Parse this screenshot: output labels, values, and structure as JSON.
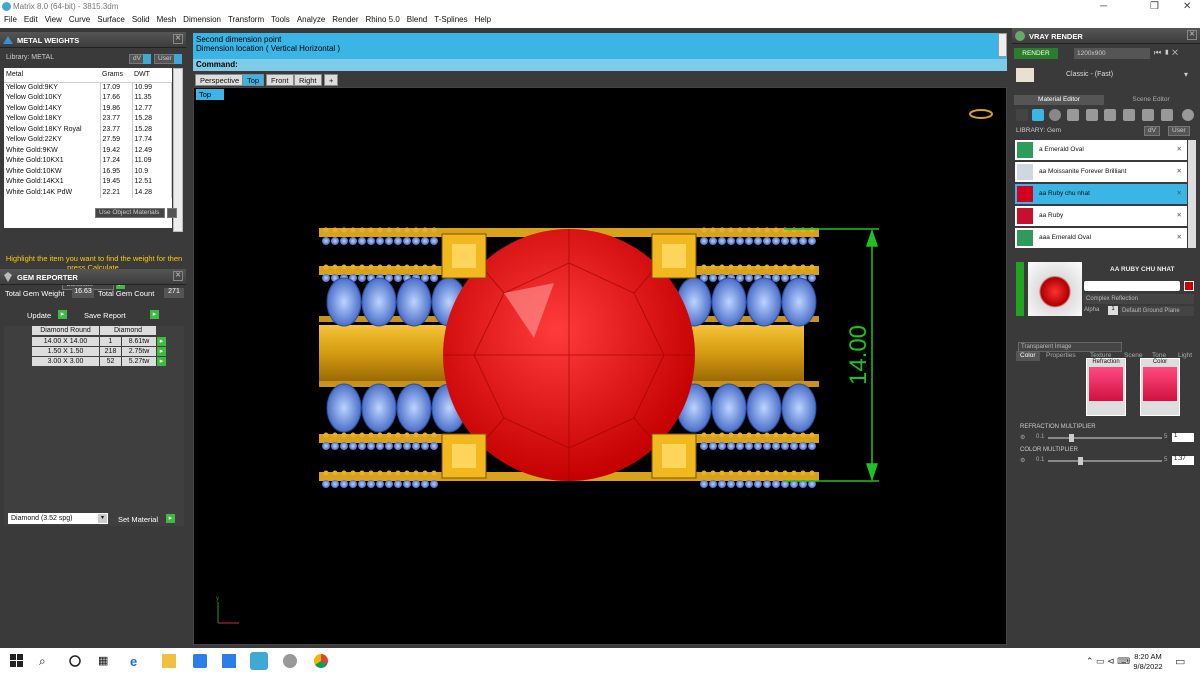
{
  "window": {
    "title": "Matrix 8.0 (64-bit) - 3815.3dm"
  },
  "menu": [
    "File",
    "Edit",
    "View",
    "Curve",
    "Surface",
    "Solid",
    "Mesh",
    "Dimension",
    "Transform",
    "Tools",
    "Analyze",
    "Render",
    "Rhino 5.0",
    "Blend",
    "T-Splines",
    "Help"
  ],
  "metal_weights": {
    "title": "METAL WEIGHTS",
    "library_label": "Library: METAL",
    "dv_label": "dV",
    "user_label": "User",
    "columns": [
      "Metal",
      "Grams",
      "DWT"
    ],
    "rows": [
      [
        "Yellow Gold:9KY",
        "17.09",
        "10.99"
      ],
      [
        "Yellow Gold:10KY",
        "17.66",
        "11.35"
      ],
      [
        "Yellow Gold:14KY",
        "19.86",
        "12.77"
      ],
      [
        "Yellow Gold:18KY",
        "23.77",
        "15.28"
      ],
      [
        "Yellow Gold:18KY Royal",
        "23.77",
        "15.28"
      ],
      [
        "Yellow Gold:22KY",
        "27.59",
        "17.74"
      ],
      [
        "White Gold:9KW",
        "19.42",
        "12.49"
      ],
      [
        "White Gold:10KX1",
        "17.24",
        "11.09"
      ],
      [
        "White Gold:10KW",
        "16.95",
        "10.9"
      ],
      [
        "White Gold:14KX1",
        "19.45",
        "12.51"
      ],
      [
        "White Gold:14K PdW",
        "22.21",
        "14.28"
      ]
    ],
    "use_object_materials": "Use Object Materials",
    "hint": "Highlight the item you want to find the weight for then press Calculate.",
    "calculate": "Calculate"
  },
  "gem_reporter": {
    "title": "GEM REPORTER",
    "total_gem_weight_label": "Total Gem Weight",
    "total_gem_weight": "16.63",
    "total_gem_count_label": "Total Gem Count",
    "total_gem_count": "271",
    "update": "Update",
    "save_report": "Save Report",
    "col1": "Diamond Round",
    "col2": "Diamond",
    "rows": [
      [
        "14.00 X 14.00",
        "1",
        "8.61tw"
      ],
      [
        "1.50 X 1.50",
        "218",
        "2.75tw"
      ],
      [
        "3.00 X 3.00",
        "52",
        "5.27tw"
      ]
    ],
    "material_select": "Diamond    (3.52 spg)",
    "set_material": "Set Material"
  },
  "command": {
    "line1": "Second dimension point",
    "line2": "Dimension location ( Vertical  Horizontal )",
    "prompt": "Command:"
  },
  "view_tabs": [
    "Perspective",
    "Top",
    "Front",
    "Right",
    "+"
  ],
  "viewport": {
    "label": "Top",
    "dimension": "14.00",
    "axis_label": "y"
  },
  "vray": {
    "title": "VRAY RENDER",
    "render": "RENDER",
    "resolution": "1200x900",
    "preset": "Classic - (Fast)",
    "tab_material": "Material Editor",
    "tab_scene": "Scene Editor",
    "library": "LIBRARY: Gem",
    "dv_label": "dV",
    "user_label": "User",
    "materials": [
      "a Emerald Oval",
      "aa Moissanite Forever Brilliant",
      "aa Ruby chu nhat",
      "aa Ruby",
      "aaa Emerald Oval"
    ],
    "selected_name": "AA RUBY CHU NHAT",
    "material_type": "Complex Reflection",
    "alpha_label": "Alpha",
    "alpha_value": "1",
    "ground": "Default Ground Plane",
    "subtabs": [
      "Color",
      "Properties",
      "Texture",
      "Scene",
      "Tone",
      "Light"
    ],
    "color_mode": "Transparent Image",
    "refraction_label": "Refraction",
    "color_label": "Color",
    "refraction_multiplier_label": "REFRACTION MULTIPLIER",
    "refraction_multiplier_min": "0.1",
    "refraction_multiplier_max": "5",
    "refraction_multiplier": "1",
    "refraction_multiplier_fraction": 0.18,
    "color_multiplier_label": "COLOR MULTIPLIER",
    "color_multiplier_min": "0.1",
    "color_multiplier_max": "5",
    "color_multiplier": "1.37",
    "color_multiplier_fraction": 0.26
  },
  "taskbar": {
    "time": "8:20 AM",
    "date": "9/8/2022"
  }
}
